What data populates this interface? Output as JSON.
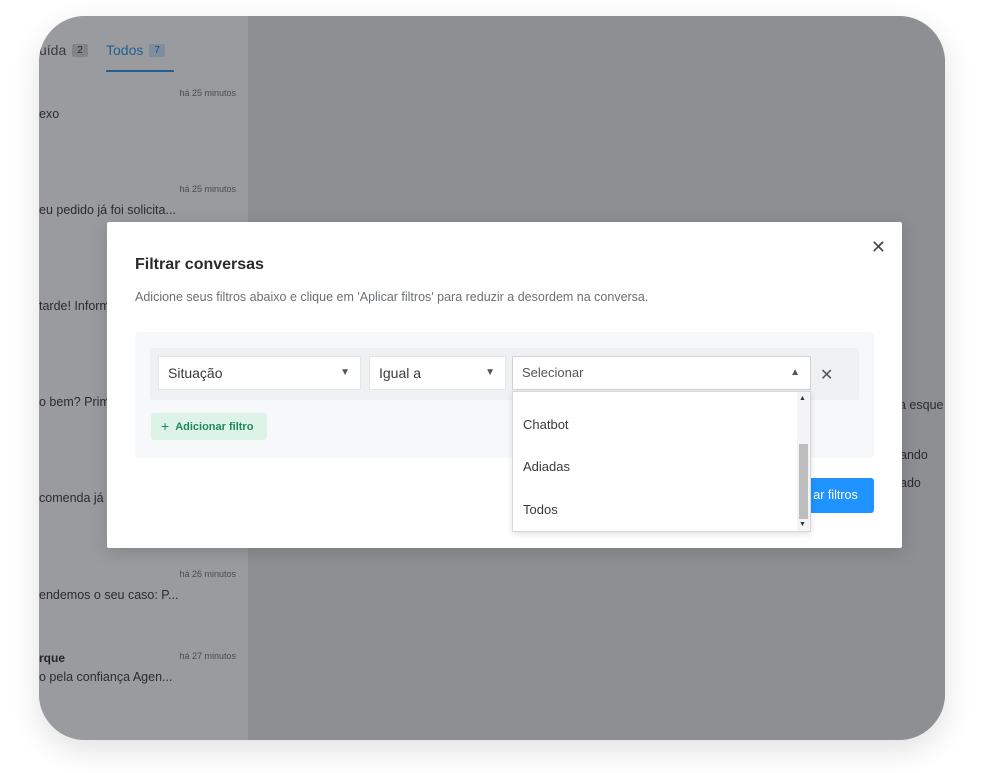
{
  "tabs": [
    {
      "label": "uída",
      "count": "2"
    },
    {
      "label": "Todos",
      "count": "7"
    }
  ],
  "conversations": [
    {
      "time": "há 25 minutos",
      "name": "",
      "message": "exo"
    },
    {
      "time": "há 25 minutos",
      "name": "",
      "message": "eu pedido já foi solicita..."
    },
    {
      "time": "",
      "name": "",
      "message": "tarde! Inform"
    },
    {
      "time": "",
      "name": "",
      "message": "o bem? Prim"
    },
    {
      "time": "",
      "name": "",
      "message": "comenda já"
    },
    {
      "time": "há 26 minutos",
      "name": "",
      "message": "endemos o seu caso: P..."
    },
    {
      "time": "há 27 minutos",
      "name": "rque",
      "message": "o pela confiança Agen..."
    }
  ],
  "background_right": [
    "a esque",
    "ando",
    "ado"
  ],
  "modal": {
    "title": "Filtrar conversas",
    "description": "Adicione seus filtros abaixo e clique em 'Aplicar filtros' para reduzir a desordem na conversa.",
    "close_icon": "close-icon",
    "filter": {
      "attribute": "Situação",
      "operator": "Igual a",
      "value_placeholder": "Selecionar"
    },
    "add_filter_label": "Adicionar filtro",
    "apply_label": "ar filtros",
    "dropdown_options": [
      "Chatbot",
      "Adiadas",
      "Todos"
    ]
  },
  "colors": {
    "accent": "#1f93ff",
    "add_filter_bg": "#def3e8",
    "add_filter_text": "#1f8a56",
    "overlay": "#8f9092"
  }
}
